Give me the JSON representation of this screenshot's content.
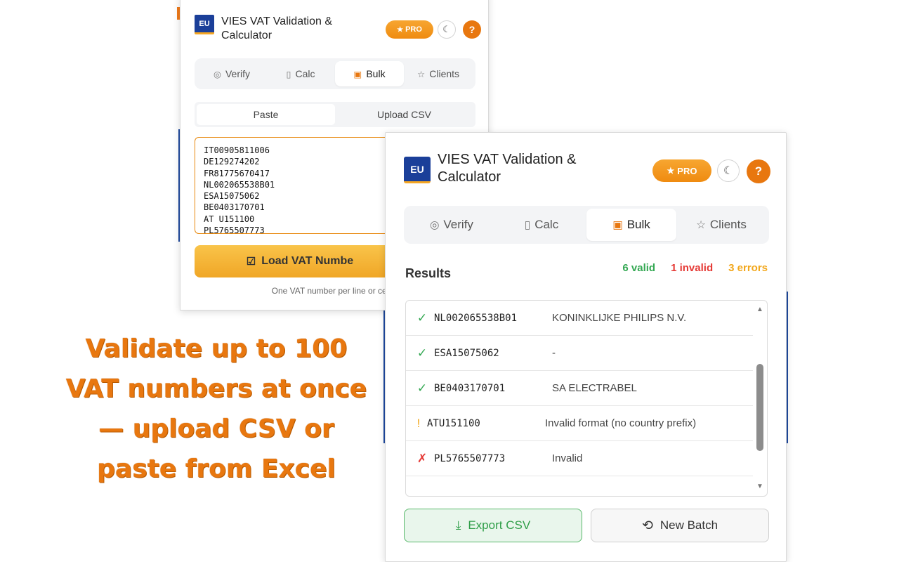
{
  "marketing_text": "Validate up to 100 VAT numbers at once — upload CSV or paste from Excel",
  "extension": {
    "badge": "EU",
    "title": "VIES VAT Validation & Calculator",
    "pro_label": "PRO",
    "help_label": "?",
    "tabs": [
      {
        "label": "Verify",
        "icon": "check-circle-icon"
      },
      {
        "label": "Calc",
        "icon": "calculator-icon"
      },
      {
        "label": "Bulk",
        "icon": "file-icon"
      },
      {
        "label": "Clients",
        "icon": "star-icon"
      }
    ],
    "active_tab": "Bulk"
  },
  "back_panel": {
    "subtabs": [
      "Paste",
      "Upload CSV"
    ],
    "active_subtab": "Paste",
    "textarea_value": "IT00905811006\nDE129274202\nFR81775670417\nNL002065538B01\nESA15075062\nBE0403170701\nAT U151100\nPL5765507773",
    "load_button": "Load VAT Numbe",
    "hint": "One VAT number per line or cell (r"
  },
  "front_panel": {
    "results_title": "Results",
    "counts": {
      "valid": "6 valid",
      "invalid": "1 invalid",
      "errors": "3 errors"
    },
    "rows": [
      {
        "status": "valid",
        "symbol": "✓",
        "vat": "NL002065538B01",
        "name": "KONINKLIJKE PHILIPS N.V."
      },
      {
        "status": "valid",
        "symbol": "✓",
        "vat": "ESA15075062",
        "name": "-"
      },
      {
        "status": "valid",
        "symbol": "✓",
        "vat": "BE0403170701",
        "name": "SA ELECTRABEL"
      },
      {
        "status": "warn",
        "symbol": "!",
        "vat": "ATU151100",
        "name": "Invalid format (no country prefix)"
      },
      {
        "status": "invalid",
        "symbol": "✗",
        "vat": "PL5765507773",
        "name": "Invalid"
      }
    ],
    "export_label": "Export CSV",
    "new_batch_label": "New Batch"
  },
  "colors": {
    "accent": "#e8770f",
    "valid": "#34a853",
    "invalid": "#e53935",
    "warning": "#f2a71b",
    "eu_blue": "#1b3f99"
  }
}
